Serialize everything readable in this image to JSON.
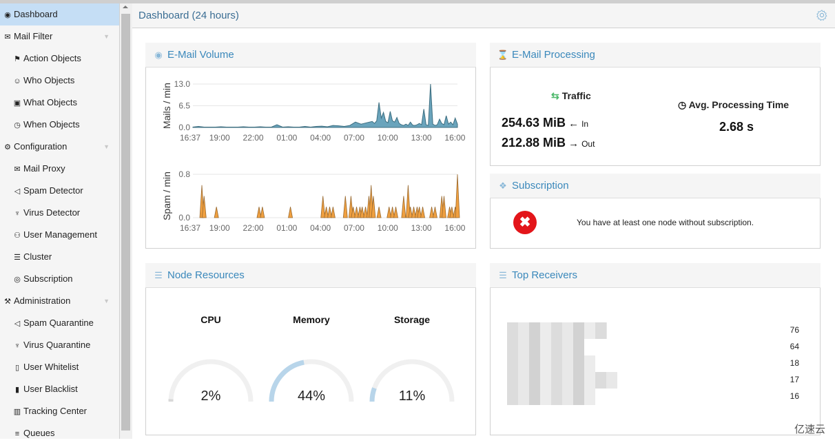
{
  "sidebar": {
    "items": [
      {
        "label": "Dashboard",
        "icon": "dashboard-icon",
        "level": "top",
        "active": true
      },
      {
        "label": "Mail Filter",
        "icon": "envelope-icon",
        "level": "top",
        "expandable": true
      },
      {
        "label": "Action Objects",
        "icon": "flag-icon",
        "level": "sub"
      },
      {
        "label": "Who Objects",
        "icon": "user-circle-icon",
        "level": "sub"
      },
      {
        "label": "What Objects",
        "icon": "cube-icon",
        "level": "sub"
      },
      {
        "label": "When Objects",
        "icon": "clock-icon",
        "level": "sub"
      },
      {
        "label": "Configuration",
        "icon": "cogs-icon",
        "level": "top",
        "expandable": true
      },
      {
        "label": "Mail Proxy",
        "icon": "envelope-outline-icon",
        "level": "sub"
      },
      {
        "label": "Spam Detector",
        "icon": "bullhorn-icon",
        "level": "sub"
      },
      {
        "label": "Virus Detector",
        "icon": "bug-icon",
        "level": "sub"
      },
      {
        "label": "User Management",
        "icon": "users-icon",
        "level": "sub"
      },
      {
        "label": "Cluster",
        "icon": "server-icon",
        "level": "sub"
      },
      {
        "label": "Subscription",
        "icon": "life-ring-icon",
        "level": "sub"
      },
      {
        "label": "Administration",
        "icon": "wrench-icon",
        "level": "top",
        "expandable": true
      },
      {
        "label": "Spam Quarantine",
        "icon": "bullhorn-icon",
        "level": "sub"
      },
      {
        "label": "Virus Quarantine",
        "icon": "bug-icon",
        "level": "sub"
      },
      {
        "label": "User Whitelist",
        "icon": "file-outline-icon",
        "level": "sub"
      },
      {
        "label": "User Blacklist",
        "icon": "file-icon",
        "level": "sub"
      },
      {
        "label": "Tracking Center",
        "icon": "map-icon",
        "level": "sub"
      },
      {
        "label": "Queues",
        "icon": "bars-icon",
        "level": "sub"
      }
    ]
  },
  "header": {
    "title": "Dashboard (24 hours)",
    "settings_icon": "gear-icon"
  },
  "email_volume": {
    "title": "E-Mail Volume",
    "icon": "dashboard-icon",
    "colors": {
      "mail": "#5a9ab5",
      "mail_line": "#3d6e80",
      "spam": "#f0a040",
      "spam_line": "#9a6a30"
    }
  },
  "chart_data": [
    {
      "type": "area",
      "title": "Mails / min",
      "ylabel": "Mails / min",
      "ylim": [
        0,
        13.0
      ],
      "yticks": [
        "13.0",
        "6.5",
        "0.0"
      ],
      "xticks": [
        "16:37",
        "19:00",
        "22:00",
        "01:00",
        "04:00",
        "07:00",
        "10:00",
        "13:00",
        "16:00"
      ],
      "x_hours_from_start": [
        0,
        0.5,
        1,
        1.5,
        2,
        2.5,
        3,
        3.5,
        4,
        4.5,
        5,
        5.5,
        6,
        6.5,
        7,
        7.5,
        8,
        8.5,
        9,
        9.5,
        10,
        10.5,
        11,
        11.5,
        12,
        12.5,
        13,
        13.5,
        14,
        14.5,
        15,
        15.5,
        16,
        16.2,
        16.4,
        16.6,
        16.8,
        17,
        17.2,
        17.4,
        17.6,
        17.8,
        18,
        18.2,
        18.4,
        18.6,
        18.8,
        19,
        19.2,
        19.4,
        19.6,
        19.8,
        20,
        20.2,
        20.4,
        20.6,
        20.8,
        21,
        21.2,
        21.4,
        21.6,
        21.8,
        22,
        22.2,
        22.4,
        22.6,
        22.8,
        23,
        23.2,
        23.4,
        23.6
      ],
      "values": [
        0.1,
        0.3,
        0.1,
        0.1,
        0.1,
        0.2,
        0.1,
        0.1,
        0.1,
        0.2,
        0.1,
        0.1,
        0.2,
        0.1,
        0.1,
        0.8,
        0.1,
        0.2,
        0.1,
        0.1,
        0.3,
        0.1,
        0.3,
        0.4,
        0.2,
        0.6,
        0.5,
        0.3,
        0.6,
        1.6,
        1.0,
        1.4,
        1.8,
        1.2,
        2.0,
        7.5,
        2.8,
        4.5,
        1.8,
        1.4,
        4.8,
        2.0,
        1.6,
        3.0,
        1.2,
        0.8,
        0.6,
        1.0,
        0.6,
        1.6,
        0.7,
        0.6,
        0.8,
        1.2,
        0.8,
        5.5,
        0.8,
        0.6,
        13.0,
        1.0,
        0.6,
        0.8,
        2.5,
        1.2,
        0.8,
        3.5,
        1.0,
        1.6,
        0.8,
        2.8,
        1.0
      ]
    },
    {
      "type": "area",
      "title": "Spam / min",
      "ylabel": "Spam / min",
      "ylim": [
        0,
        0.8
      ],
      "yticks": [
        "0.8",
        "0.0"
      ],
      "xticks": [
        "16:37",
        "19:00",
        "22:00",
        "01:00",
        "04:00",
        "07:00",
        "10:00",
        "13:00",
        "16:00"
      ],
      "spikes": [
        [
          0.8,
          0.6
        ],
        [
          1.0,
          0.4
        ],
        [
          2.1,
          0.2
        ],
        [
          5.9,
          0.2
        ],
        [
          6.2,
          0.2
        ],
        [
          8.7,
          0.2
        ],
        [
          11.6,
          0.4
        ],
        [
          11.9,
          0.2
        ],
        [
          12.2,
          0.2
        ],
        [
          12.5,
          0.2
        ],
        [
          13.6,
          0.4
        ],
        [
          14.1,
          0.4
        ],
        [
          14.3,
          0.2
        ],
        [
          14.6,
          0.2
        ],
        [
          14.9,
          0.2
        ],
        [
          15.1,
          0.2
        ],
        [
          15.4,
          0.2
        ],
        [
          15.7,
          0.4
        ],
        [
          15.9,
          0.6
        ],
        [
          16.1,
          0.4
        ],
        [
          16.6,
          0.2
        ],
        [
          17.5,
          0.2
        ],
        [
          17.8,
          0.2
        ],
        [
          18.1,
          0.2
        ],
        [
          18.8,
          0.4
        ],
        [
          19.2,
          0.6
        ],
        [
          19.4,
          0.2
        ],
        [
          19.7,
          0.2
        ],
        [
          20.0,
          0.2
        ],
        [
          20.2,
          0.2
        ],
        [
          20.5,
          0.2
        ],
        [
          21.3,
          0.2
        ],
        [
          21.6,
          0.2
        ],
        [
          22.2,
          0.4
        ],
        [
          22.4,
          0.4
        ],
        [
          22.9,
          0.2
        ],
        [
          23.1,
          0.2
        ],
        [
          23.4,
          0.2
        ],
        [
          23.6,
          0.8
        ]
      ]
    }
  ],
  "processing": {
    "title": "E-Mail Processing",
    "icon": "hourglass-icon",
    "traffic_label": "Traffic",
    "in_value": "254.63 MiB",
    "in_arrow": "←",
    "in_label": "In",
    "out_value": "212.88 MiB",
    "out_arrow": "→",
    "out_label": "Out",
    "avg_label": "Avg. Processing Time",
    "avg_value": "2.68 s"
  },
  "subscription": {
    "title": "Subscription",
    "icon": "ticket-icon",
    "message": "You have at least one node without subscription.",
    "status_color": "#e3151a"
  },
  "node_resources": {
    "title": "Node Resources",
    "icon": "server-icon",
    "gauges": [
      {
        "label": "CPU",
        "value_text": "2%",
        "fraction": 0.02
      },
      {
        "label": "Memory",
        "value_text": "44%",
        "fraction": 0.44
      },
      {
        "label": "Storage",
        "value_text": "11%",
        "fraction": 0.11
      }
    ],
    "gauge_color": "#b8d5ea",
    "track_color": "#f0f0f0"
  },
  "top_receivers": {
    "title": "Top Receivers",
    "icon": "list-icon",
    "rows": [
      {
        "name": "[redacted]",
        "count": "76"
      },
      {
        "name": "[redacted]",
        "count": "64"
      },
      {
        "name": "[redacted]",
        "count": "18"
      },
      {
        "name": "[redacted]",
        "count": "17"
      },
      {
        "name": "[redacted]",
        "count": "16"
      }
    ]
  },
  "watermark": "亿速云"
}
